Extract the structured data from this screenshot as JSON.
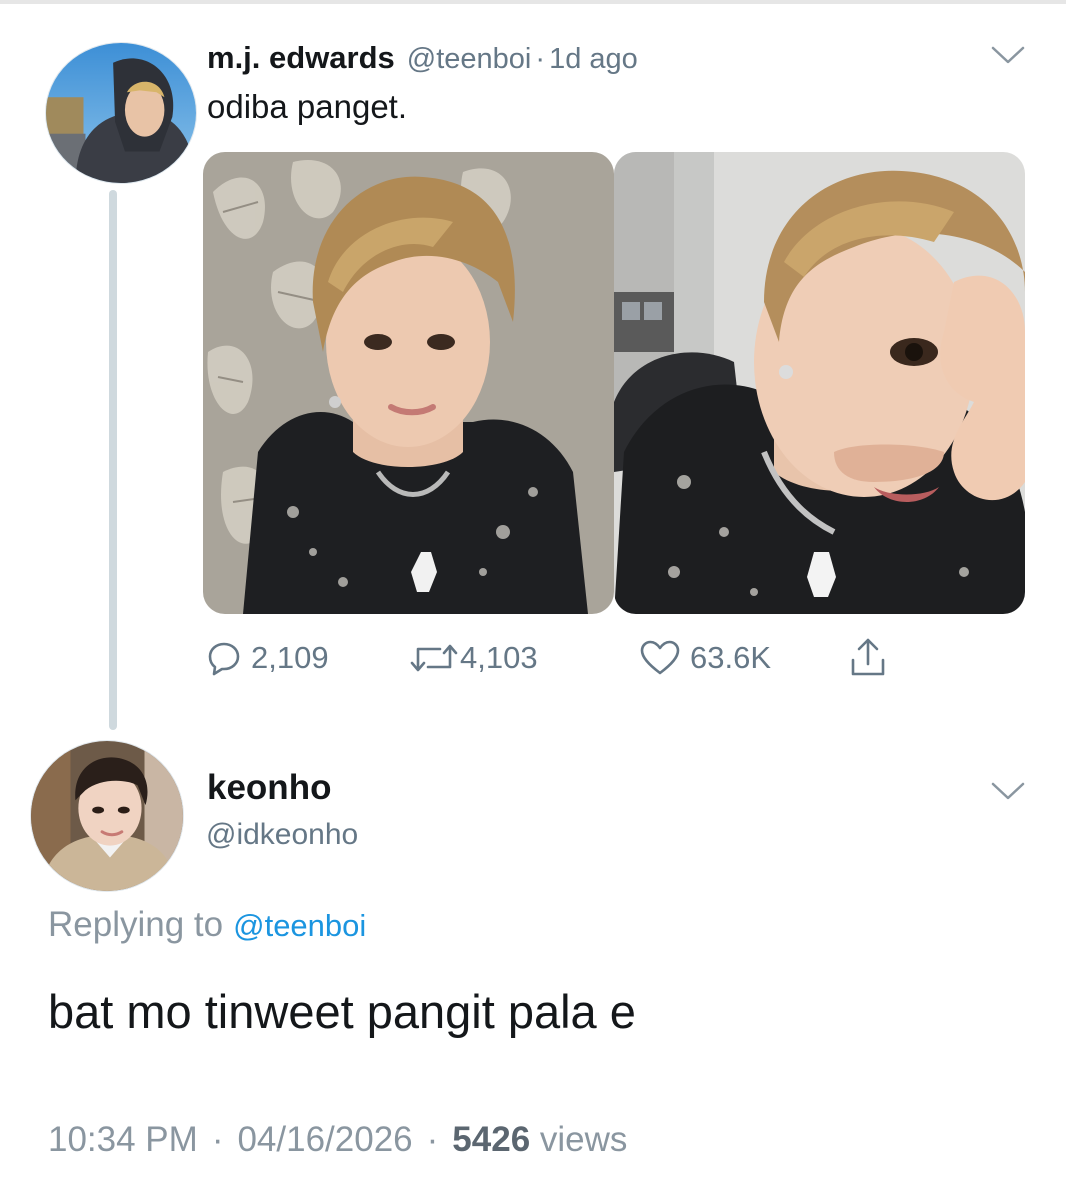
{
  "tweet": {
    "author_name": "m.j. edwards",
    "author_handle": "@teenboi",
    "separator": "·",
    "time_ago": "1d ago",
    "text": "odiba panget.",
    "actions": {
      "reply_count": "2,109",
      "retweet_count": "4,103",
      "like_count": "63.6K"
    },
    "media": [
      {
        "icon": "photo-selfie-patterned-wall"
      },
      {
        "icon": "photo-selfie-hand-gesture"
      }
    ]
  },
  "reply": {
    "author_name": "keonho",
    "author_handle": "@idkeonho",
    "replying_label": "Replying to",
    "replying_to": "@teenboi",
    "text": "bat mo tinweet pangit pala e",
    "time": "10:34 PM",
    "date": "04/16/2026",
    "separator": "·",
    "views_count": "5426",
    "views_label": "views"
  },
  "icons": {
    "more": "chevron-down-icon",
    "reply": "speech-bubble-icon",
    "retweet": "retweet-arrows-icon",
    "like": "heart-icon",
    "share": "share-upload-icon"
  },
  "colors": {
    "text": "#14171a",
    "muted": "#657786",
    "link": "#1b95e0",
    "thread_line": "#cfd9de"
  }
}
